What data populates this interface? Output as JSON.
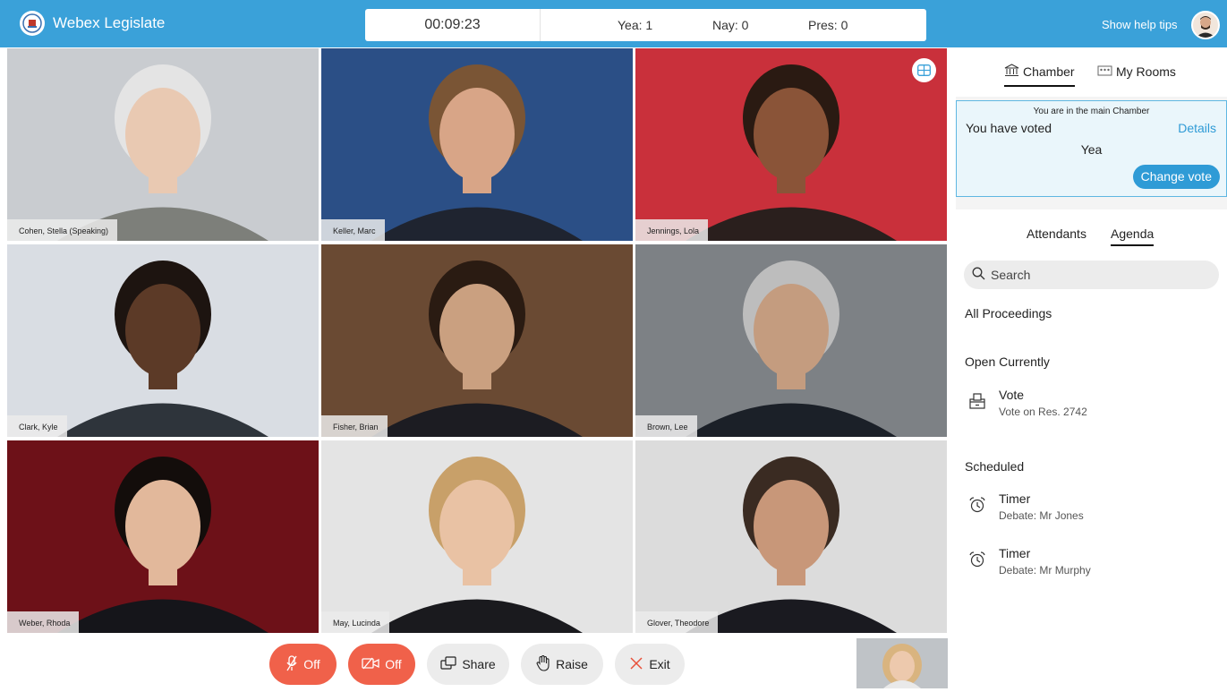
{
  "header": {
    "brand": "Webex Legislate",
    "timer": "00:09:23",
    "yea": "Yea: 1",
    "nay": "Nay: 0",
    "pres": "Pres: 0",
    "help": "Show help tips"
  },
  "tiles": [
    {
      "name": "Cohen, Stella  (Speaking)",
      "bg": "#c9ccd0",
      "skin": "#e9c9b2",
      "hair": "#e4e4e4",
      "suit": "#7d7f7a"
    },
    {
      "name": "Keller, Marc",
      "bg": "#2b4f86",
      "skin": "#d8a587",
      "hair": "#7a5535",
      "suit": "#1f2430"
    },
    {
      "name": "Jennings, Lola",
      "bg": "#c9303b",
      "skin": "#8a5438",
      "hair": "#2a1a12",
      "suit": "#2a1f1d"
    },
    {
      "name": "Clark, Kyle",
      "bg": "#d9dde3",
      "skin": "#5c3a27",
      "hair": "#1d1410",
      "suit": "#2e343b"
    },
    {
      "name": "Fisher, Brian",
      "bg": "#6a4a33",
      "skin": "#caa080",
      "hair": "#2a1b12",
      "suit": "#1c1c22"
    },
    {
      "name": "Brown, Lee",
      "bg": "#7d8185",
      "skin": "#c49c7f",
      "hair": "#bdbdbd",
      "suit": "#1b2028"
    },
    {
      "name": "Weber, Rhoda",
      "bg": "#6d1118",
      "skin": "#e2b89b",
      "hair": "#130d0b",
      "suit": "#15151a"
    },
    {
      "name": "May, Lucinda",
      "bg": "#e4e4e4",
      "skin": "#e9c2a4",
      "hair": "#c8a069",
      "suit": "#1a1a1e"
    },
    {
      "name": "Glover, Theodore",
      "bg": "#dcdcdc",
      "skin": "#c89779",
      "hair": "#3a2b22",
      "suit": "#1a1a20"
    }
  ],
  "controls": {
    "mute": "Off",
    "video": "Off",
    "share": "Share",
    "raise": "Raise",
    "exit": "Exit"
  },
  "sidebar": {
    "tab_chamber": "Chamber",
    "tab_rooms": "My Rooms",
    "status_header": "You are in the main Chamber",
    "voted": "You have voted",
    "details": "Details",
    "vote_value": "Yea",
    "change_vote": "Change vote",
    "tab_attendants": "Attendants",
    "tab_agenda": "Agenda",
    "search_placeholder": "Search",
    "all_proceedings": "All Proceedings",
    "open_currently": "Open Currently",
    "open_items": [
      {
        "title": "Vote",
        "sub": "Vote on Res. 2742"
      }
    ],
    "scheduled": "Scheduled",
    "scheduled_items": [
      {
        "title": "Timer",
        "sub": "Debate: Mr Jones"
      },
      {
        "title": "Timer",
        "sub": "Debate: Mr Murphy"
      }
    ]
  },
  "colors": {
    "brand": "#3aa1d9",
    "accent": "#2f9bd6",
    "danger": "#f0614a"
  }
}
